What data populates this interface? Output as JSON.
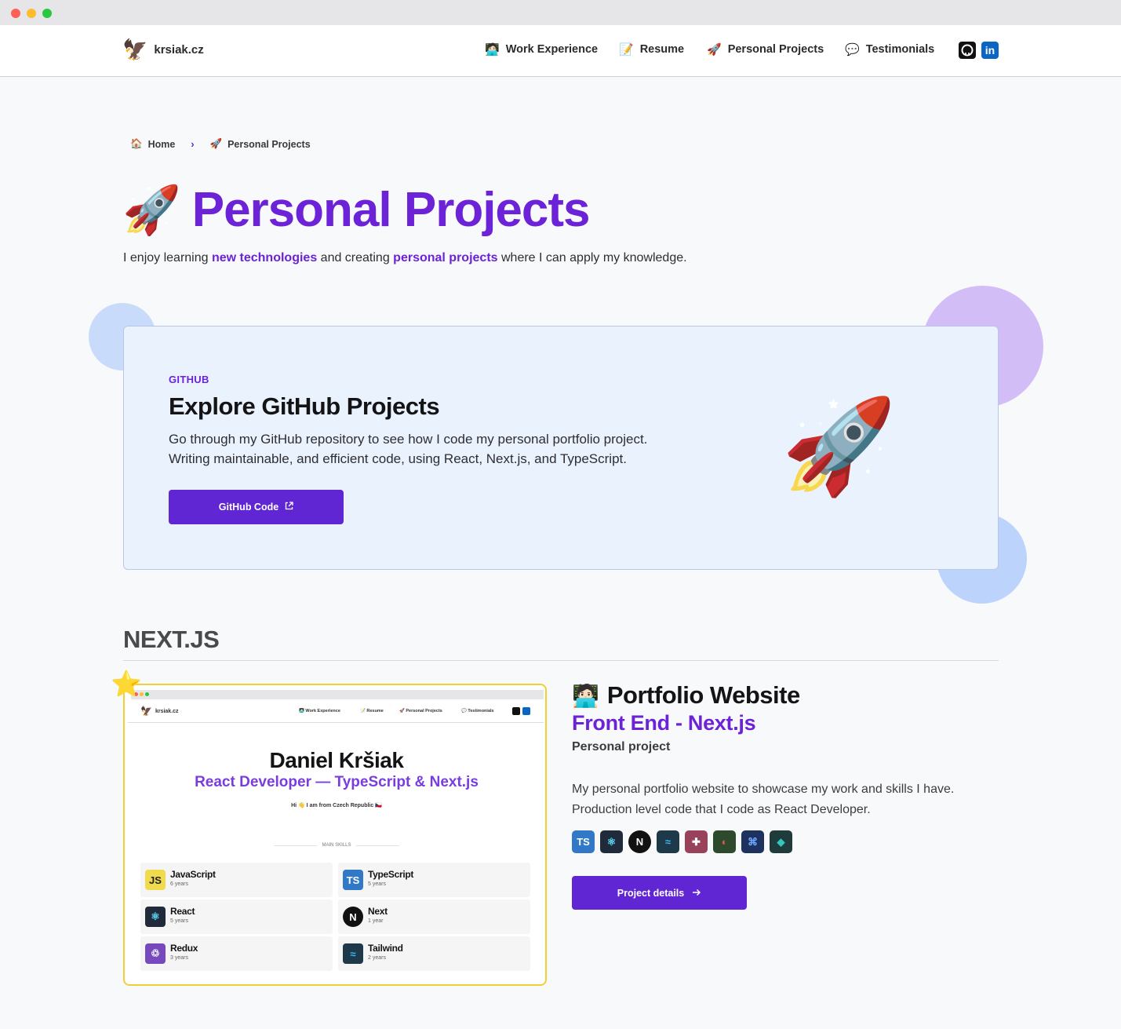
{
  "nav": {
    "brand": "krsiak.cz",
    "brand_icon": "eagle-icon",
    "items": [
      {
        "emoji": "🧑🏻‍💻",
        "label": "Work Experience"
      },
      {
        "emoji": "📝",
        "label": "Resume"
      },
      {
        "emoji": "🚀",
        "label": "Personal Projects"
      },
      {
        "emoji": "💬",
        "label": "Testimonials"
      }
    ],
    "github_icon": "github-icon",
    "linkedin_label": "in"
  },
  "breadcrumb": {
    "home_emoji": "🏠",
    "home": "Home",
    "separator": "›",
    "current_emoji": "🚀",
    "current": "Personal Projects"
  },
  "page": {
    "title_emoji": "🚀",
    "title": "Personal Projects",
    "intro_1": "I enjoy learning ",
    "intro_hl1": "new technologies",
    "intro_2": " and creating ",
    "intro_hl2": "personal projects",
    "intro_3": " where I can apply my knowledge."
  },
  "github_card": {
    "eyebrow": "GITHUB",
    "title": "Explore GitHub Projects",
    "desc_line1": "Go through my GitHub repository to see how I code my personal portfolio project.",
    "desc_line2": "Writing maintainable, and efficient code, using React, Next.js, and TypeScript.",
    "button": "GitHub Code",
    "button_icon": "external-link-icon",
    "illustration": "🚀"
  },
  "section": {
    "title": "NEXT.JS"
  },
  "project": {
    "badge": "⭐",
    "thumbnail": {
      "brand": "krsiak.cz",
      "nav": [
        "🧑🏻‍💻 Work Experience",
        "📝 Resume",
        "🚀 Personal Projects",
        "💬 Testimonials"
      ],
      "name": "Daniel Kršiak",
      "subtitle": "React Developer — TypeScript & Next.js",
      "hi": "Hi 👋 I am from Czech Republic 🇨🇿",
      "skills_label": "MAIN SKILLS",
      "skills": [
        {
          "name": "JavaScript",
          "years": "6 years",
          "icon": "JS"
        },
        {
          "name": "TypeScript",
          "years": "5 years",
          "icon": "TS"
        },
        {
          "name": "React",
          "years": "5 years",
          "icon": "⚛"
        },
        {
          "name": "Next",
          "years": "1 year",
          "icon": "N"
        },
        {
          "name": "Redux",
          "years": "3 years",
          "icon": "♲"
        },
        {
          "name": "Tailwind",
          "years": "2 years",
          "icon": "≈"
        }
      ]
    },
    "title_emoji": "🧑🏻‍💻",
    "title": "Portfolio Website",
    "subtitle": "Front End - Next.js",
    "kind": "Personal project",
    "desc_line1": "My personal portfolio website to showcase my work and skills I have.",
    "desc_line2": "Production level code that I code as React Developer.",
    "tech": [
      {
        "name": "typescript-icon",
        "glyph": "TS",
        "color": "#3178c6"
      },
      {
        "name": "react-icon",
        "glyph": "⚛",
        "color": "#1f2a3a"
      },
      {
        "name": "nextjs-icon",
        "glyph": "N",
        "color": "#111111"
      },
      {
        "name": "tailwind-icon",
        "glyph": "≈",
        "color": "#1e3a4a"
      },
      {
        "name": "jest-icon",
        "glyph": "✚",
        "color": "#99425b"
      },
      {
        "name": "playwright-icon",
        "glyph": "◐",
        "color": "#2d4a2d"
      },
      {
        "name": "storybook-flow-icon",
        "glyph": "⌘",
        "color": "#1e3260"
      },
      {
        "name": "netlify-icon",
        "glyph": "◆",
        "color": "#1f3b3b"
      }
    ],
    "button": "Project details",
    "button_icon": "arrow-right-icon"
  },
  "colors": {
    "accent": "#6c22d6",
    "button": "#6126d4",
    "card_bg": "#eaf2fe"
  }
}
